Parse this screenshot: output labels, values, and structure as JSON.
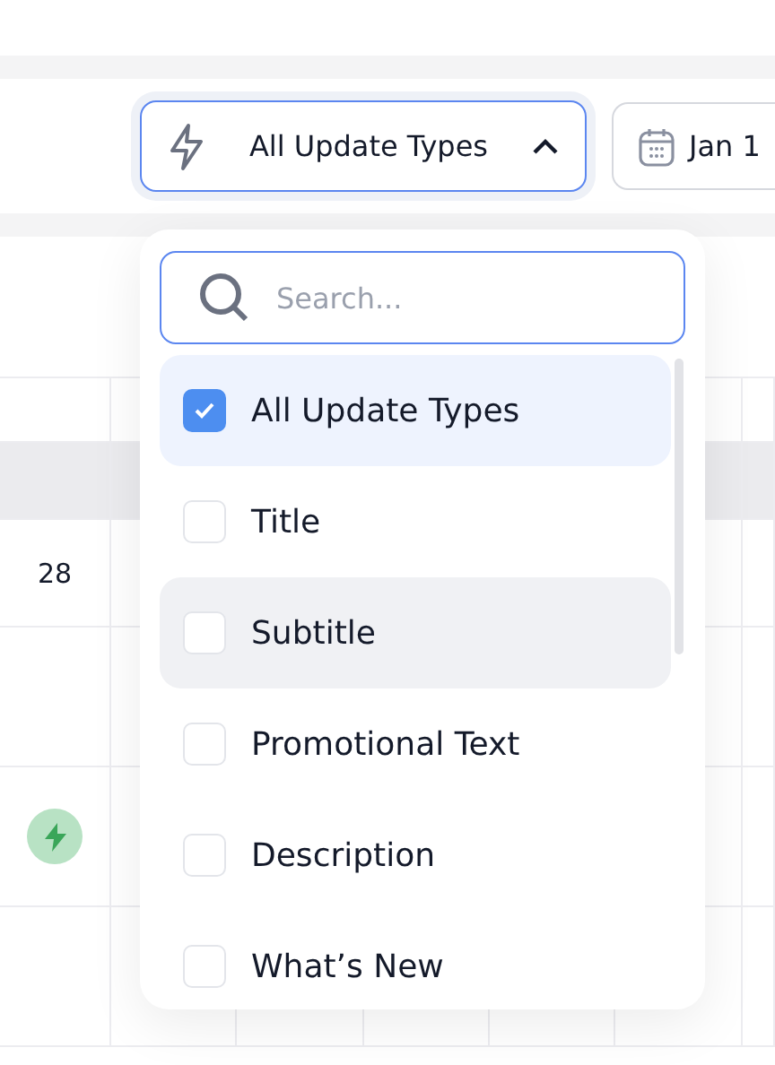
{
  "toolbar": {
    "type_filter": {
      "label": "All Update Types",
      "expanded": true
    },
    "date_filter": {
      "label": "Jan 1"
    }
  },
  "table": {
    "rows": [
      {
        "kind": "text",
        "text": "28"
      },
      {
        "kind": "blank"
      },
      {
        "kind": "update"
      },
      {
        "kind": "blank"
      }
    ]
  },
  "dropdown": {
    "search": {
      "placeholder": "Search..."
    },
    "options": [
      {
        "label": "All Update Types",
        "checked": true,
        "hovered": false
      },
      {
        "label": "Title",
        "checked": false,
        "hovered": false
      },
      {
        "label": "Subtitle",
        "checked": false,
        "hovered": true
      },
      {
        "label": "Promotional Text",
        "checked": false,
        "hovered": false
      },
      {
        "label": "Description",
        "checked": false,
        "hovered": false
      },
      {
        "label": "What’s New",
        "checked": false,
        "hovered": false
      }
    ]
  }
}
